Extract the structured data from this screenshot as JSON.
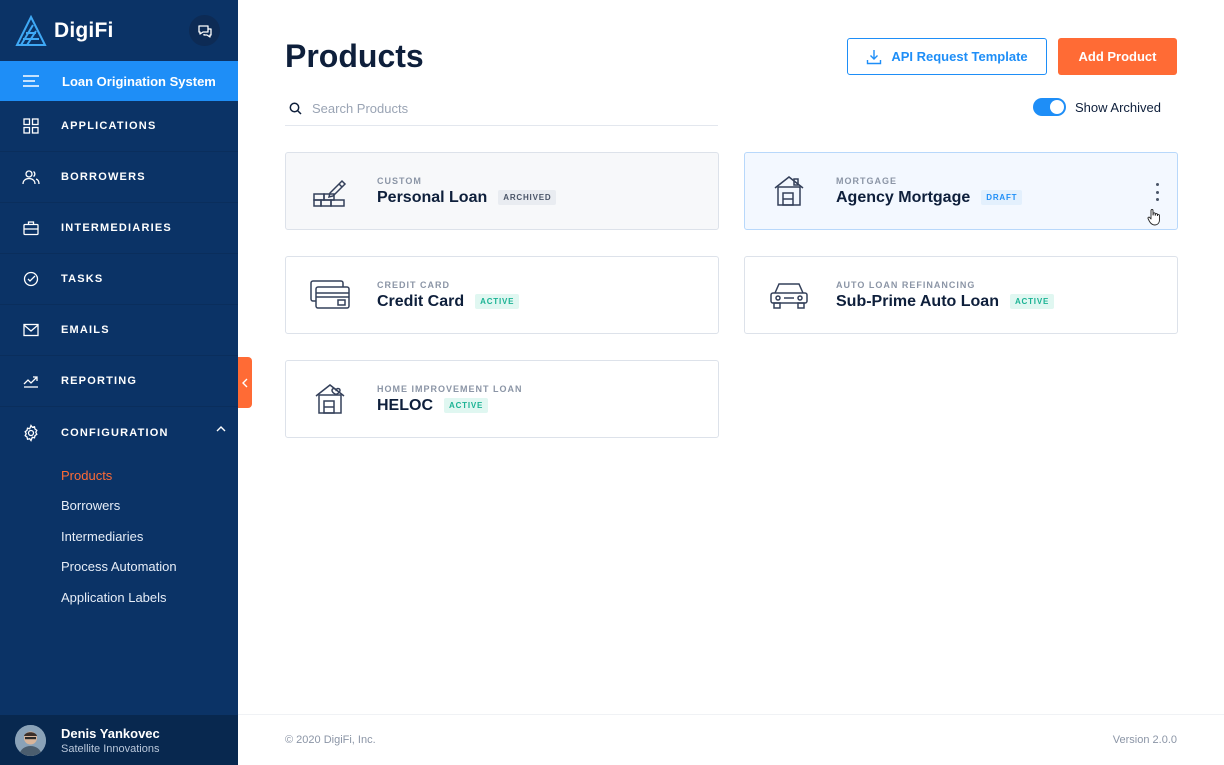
{
  "app": {
    "brand": "DigiFi",
    "module": "Loan Origination System"
  },
  "sidebar": {
    "nav": [
      {
        "label": "APPLICATIONS",
        "icon": "grid-icon"
      },
      {
        "label": "BORROWERS",
        "icon": "users-icon"
      },
      {
        "label": "INTERMEDIARIES",
        "icon": "briefcase-icon"
      },
      {
        "label": "TASKS",
        "icon": "check-circle-icon"
      },
      {
        "label": "EMAILS",
        "icon": "mail-icon"
      },
      {
        "label": "REPORTING",
        "icon": "trending-up-icon"
      },
      {
        "label": "CONFIGURATION",
        "icon": "gear-icon"
      }
    ],
    "config_items": [
      {
        "label": "Products",
        "active": true
      },
      {
        "label": "Borrowers"
      },
      {
        "label": "Intermediaries"
      },
      {
        "label": "Process Automation"
      },
      {
        "label": "Application Labels"
      }
    ],
    "user": {
      "name": "Denis Yankovec",
      "company": "Satellite Innovations"
    }
  },
  "header": {
    "title": "Products",
    "api_button": "API Request Template",
    "add_button": "Add Product",
    "search_placeholder": "Search Products",
    "toggle_label": "Show Archived",
    "toggle_on": true
  },
  "products": [
    {
      "type": "CUSTOM",
      "name": "Personal Loan",
      "status": "ARCHIVED",
      "icon": "bricks-pencil-icon"
    },
    {
      "type": "MORTGAGE",
      "name": "Agency Mortgage",
      "status": "DRAFT",
      "icon": "house-icon"
    },
    {
      "type": "CREDIT CARD",
      "name": "Credit Card",
      "status": "ACTIVE",
      "icon": "credit-card-icon"
    },
    {
      "type": "AUTO LOAN REFINANCING",
      "name": "Sub-Prime Auto Loan",
      "status": "ACTIVE",
      "icon": "car-icon"
    },
    {
      "type": "HOME IMPROVEMENT LOAN",
      "name": "HELOC",
      "status": "ACTIVE",
      "icon": "house-heart-icon"
    }
  ],
  "footer": {
    "copyright": "© 2020 DigiFi, Inc.",
    "version": "Version 2.0.0"
  },
  "colors": {
    "sidebar": "#0b3366",
    "primary": "#1e8ef7",
    "accent": "#ff6b35"
  }
}
